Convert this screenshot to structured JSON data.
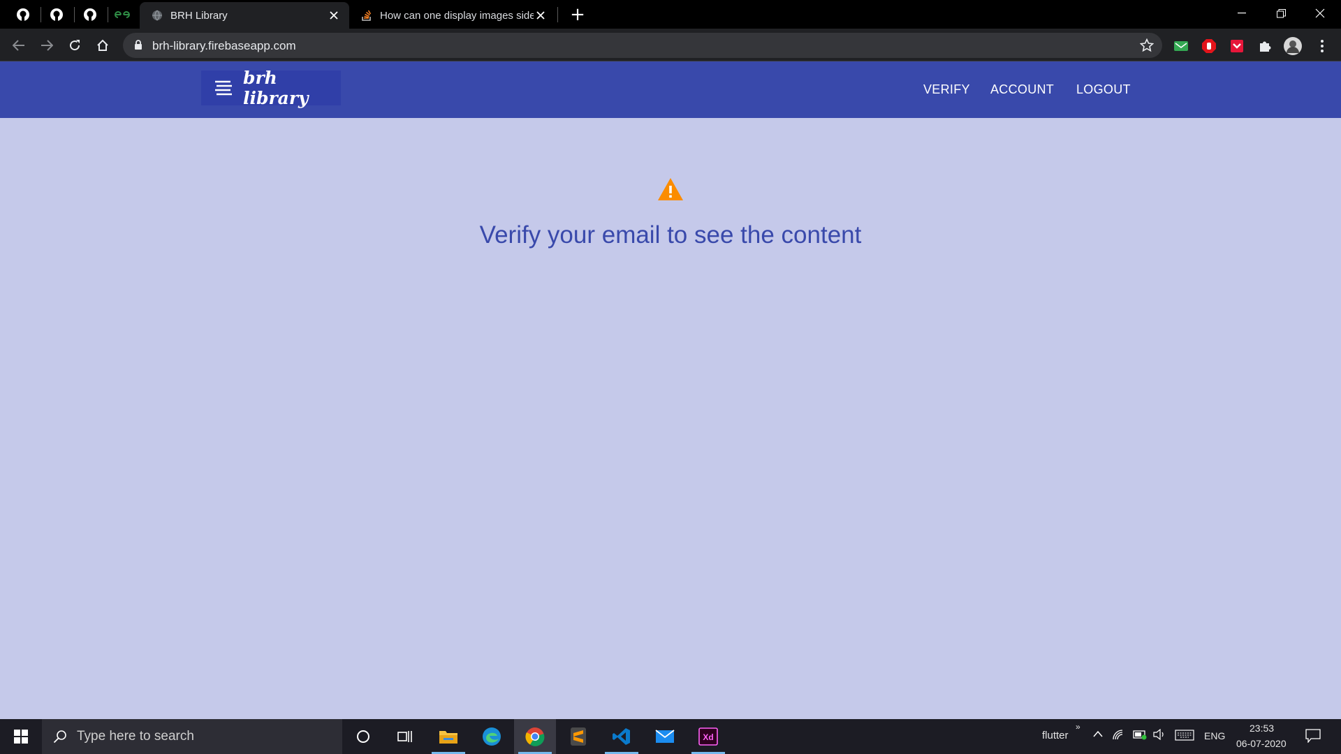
{
  "browser": {
    "tabs": [
      {
        "title": "BRH Library",
        "close": "✕"
      },
      {
        "title": "How can one display images side",
        "close": "✕"
      }
    ],
    "new_tab": "+",
    "url": "brh-library.firebaseapp.com",
    "window_controls": {
      "minimize": "—",
      "restore": "❐",
      "close": "✕"
    }
  },
  "app": {
    "brand": "brh library",
    "nav": [
      "VERIFY",
      "ACCOUNT",
      "LOGOUT"
    ],
    "message": "Verify your email to see the content",
    "warning_color": "#fb8c00",
    "primary_color": "#3949ab",
    "background_color": "#c5c9ea"
  },
  "taskbar": {
    "search_placeholder": "Type here to search",
    "toolbar_label": "flutter",
    "language": "ENG",
    "time": "23:53",
    "date": "06-07-2020"
  }
}
